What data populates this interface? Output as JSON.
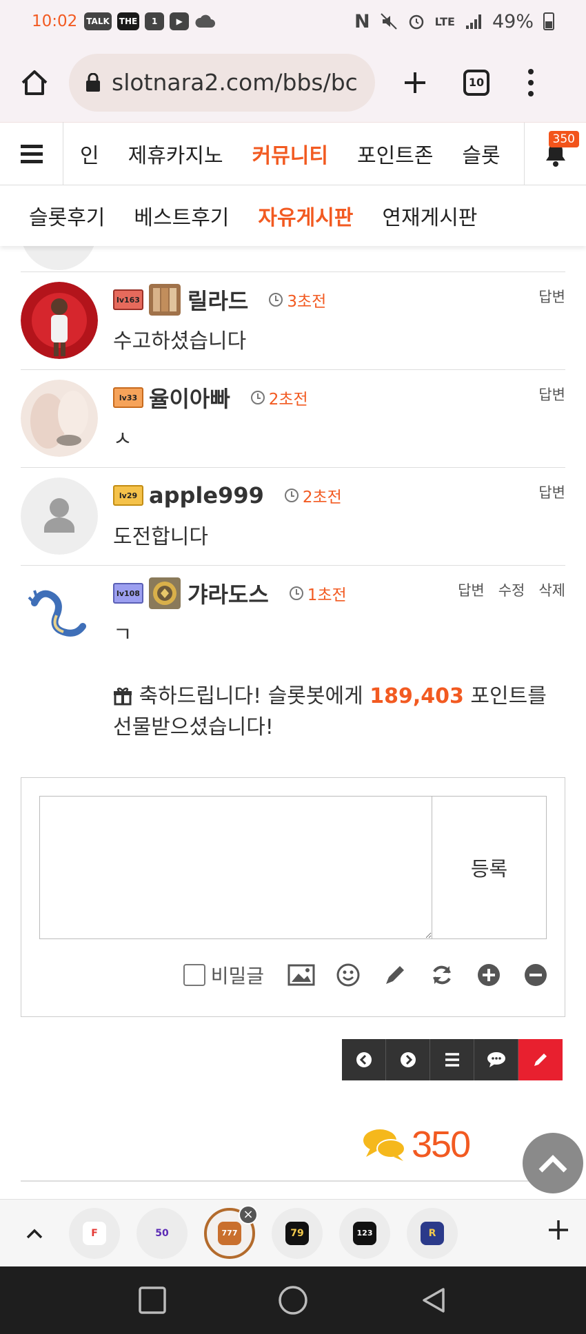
{
  "status_bar": {
    "time": "10:02",
    "left_icons": [
      "TALK",
      "THE",
      "1",
      "▶"
    ],
    "battery": "49%"
  },
  "browser": {
    "url": "slotnara2.com/bbs/bc",
    "tab_count": "10"
  },
  "main_nav": {
    "items": [
      {
        "label": "인",
        "active": false
      },
      {
        "label": "제휴카지노",
        "active": false
      },
      {
        "label": "커뮤니티",
        "active": true
      },
      {
        "label": "포인트존",
        "active": false
      },
      {
        "label": "슬롯",
        "active": false
      }
    ],
    "notification_count": "350"
  },
  "sub_nav": {
    "items": [
      {
        "label": "슬롯후기",
        "active": false
      },
      {
        "label": "베스트후기",
        "active": false
      },
      {
        "label": "자유게시판",
        "active": true
      },
      {
        "label": "연재게시판",
        "active": false
      }
    ]
  },
  "comments": [
    {
      "level": "lv163",
      "name": "릴라드",
      "time": "3초전",
      "text": "수고하셨습니다",
      "actions": [
        "답변"
      ]
    },
    {
      "level": "lv33",
      "name": "율이아빠",
      "time": "2초전",
      "text": "ㅅ",
      "actions": [
        "답변"
      ]
    },
    {
      "level": "lv29",
      "name": "apple999",
      "time": "2초전",
      "text": "도전합니다",
      "actions": [
        "답변"
      ]
    },
    {
      "level": "lv108",
      "name": "갸라도스",
      "time": "1초전",
      "text": "ㄱ",
      "actions": [
        "답변",
        "수정",
        "삭제"
      ],
      "gift_message": {
        "prefix": "축하드립니다! 슬롯봇에게 ",
        "points": "189,403",
        "suffix": " 포인트를 선물받으셨습니다!"
      }
    }
  ],
  "reply_form": {
    "submit_label": "등록",
    "secret_label": "비밀글",
    "tools": [
      "image-icon",
      "emoji-icon",
      "pencil-icon",
      "refresh-icon",
      "plus-circle-icon",
      "minus-circle-icon"
    ]
  },
  "board_buttons": [
    "prev-icon",
    "next-icon",
    "list-icon",
    "comment-icon",
    "write-icon"
  ],
  "point_counter": "350",
  "colors": {
    "accent": "#f25a21",
    "write_button": "#e8202f",
    "board_button": "#333333"
  },
  "dock": {
    "apps": [
      "F",
      "50",
      "777",
      "79",
      "123",
      "R"
    ]
  }
}
